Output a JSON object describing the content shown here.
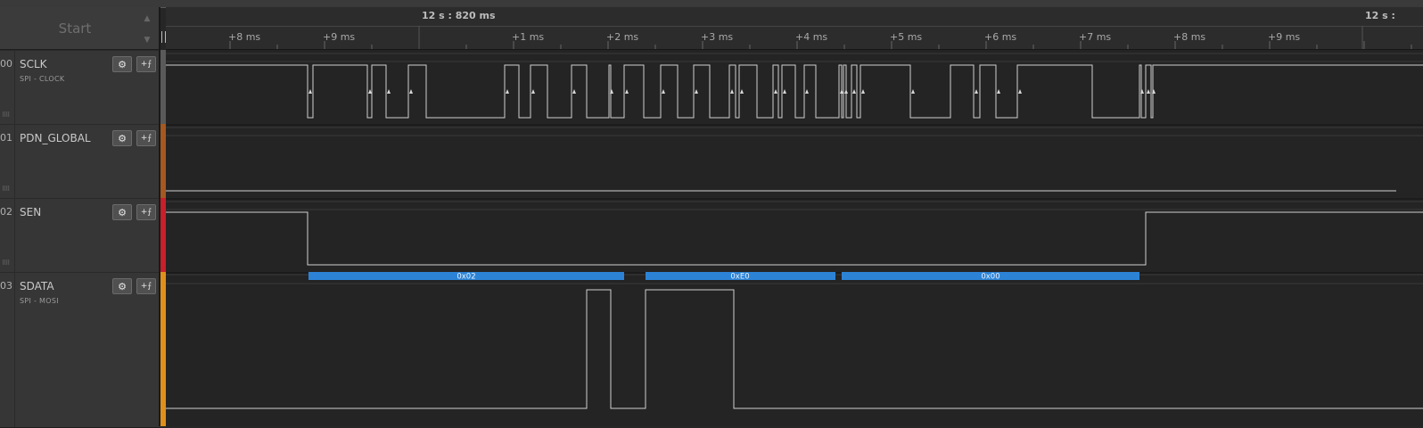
{
  "start_label": "Start",
  "ruler": {
    "timestamp_left": "12 s : 820 ms",
    "timestamp_right": "12 s :",
    "ticks": [
      "+8 ms",
      "+9 ms",
      "+1 ms",
      "+2 ms",
      "+3 ms",
      "+4 ms",
      "+5 ms",
      "+6 ms",
      "+7 ms",
      "+8 ms",
      "+9 ms"
    ]
  },
  "channels": [
    {
      "num": "00",
      "name": "SCLK",
      "sub": "SPI - CLOCK",
      "color": "#5a5a5a"
    },
    {
      "num": "01",
      "name": "PDN_GLOBAL",
      "sub": "",
      "color": "#a5581f"
    },
    {
      "num": "02",
      "name": "SEN",
      "sub": "",
      "color": "#c8202a"
    },
    {
      "num": "03",
      "name": "SDATA",
      "sub": "SPI - MOSI",
      "color": "#e0901a"
    }
  ],
  "buttons": {
    "gear": "⚙",
    "add_analyzer": "+⨍"
  },
  "decoded_bytes": [
    "0x02",
    "0xE0",
    "0x00"
  ],
  "colors": {
    "waveform": "#cfcfcf",
    "decode_bar": "#2c83d6",
    "background": "#262626"
  }
}
